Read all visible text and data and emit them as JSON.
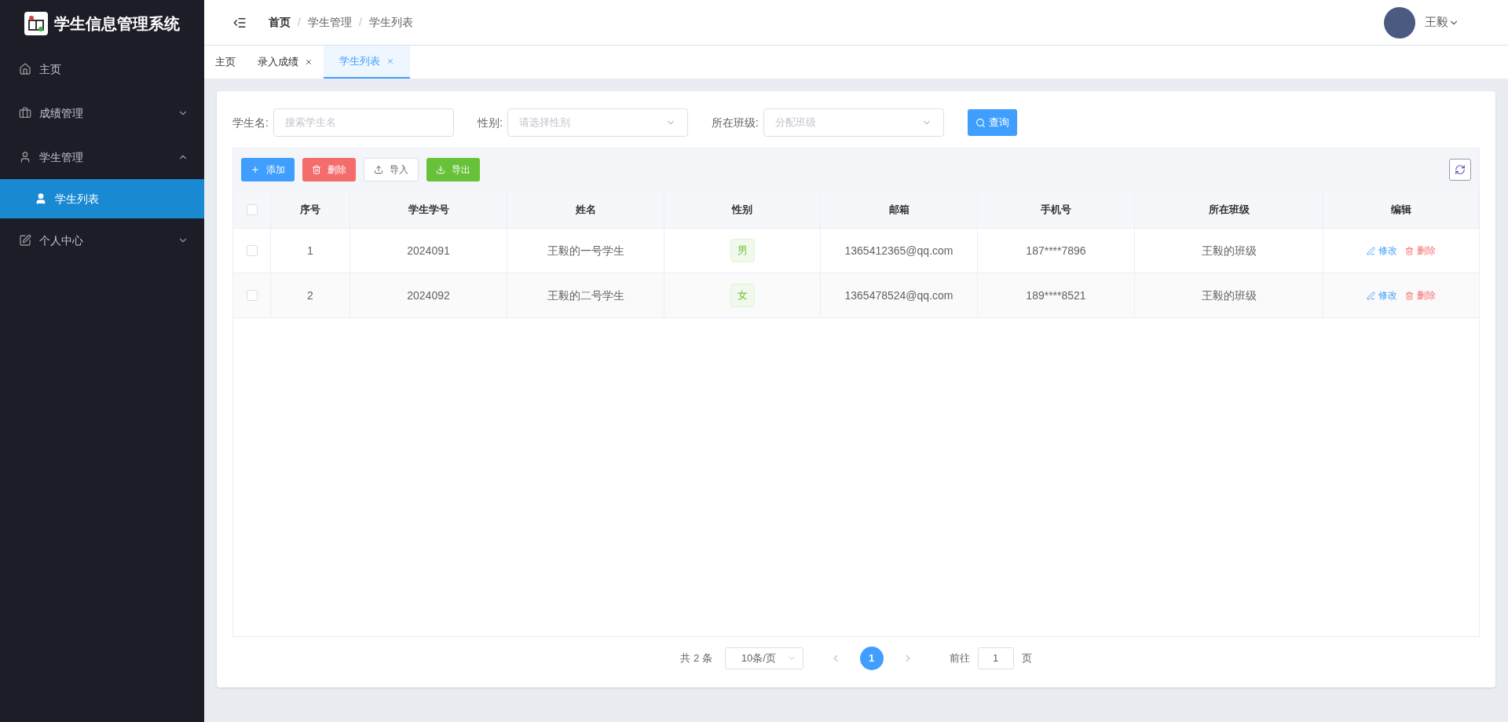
{
  "app": {
    "title": "学生信息管理系统"
  },
  "sidebar": {
    "items": [
      {
        "label": "主页"
      },
      {
        "label": "成绩管理",
        "expanded": false
      },
      {
        "label": "学生管理",
        "expanded": true,
        "children": [
          {
            "label": "学生列表",
            "selected": true
          }
        ]
      },
      {
        "label": "个人中心",
        "expanded": false
      }
    ]
  },
  "breadcrumb": [
    "首页",
    "学生管理",
    "学生列表"
  ],
  "breadcrumb_separator": "/",
  "user": {
    "name": "王毅"
  },
  "tabs": [
    {
      "label": "主页",
      "selected": false,
      "closable": false
    },
    {
      "label": "录入成绩",
      "selected": false,
      "closable": true
    },
    {
      "label": "学生列表",
      "selected": true,
      "closable": true
    }
  ],
  "filters": [
    {
      "kind": "input",
      "label": "学生名:",
      "placeholder": "搜索学生名"
    },
    {
      "kind": "select",
      "label": "性别:",
      "placeholder": "请选择性别"
    },
    {
      "kind": "select",
      "label": "所在班级:",
      "placeholder": "分配班级"
    }
  ],
  "search_button": "查询",
  "toolbar": [
    {
      "kind": "add",
      "label": "添加"
    },
    {
      "kind": "delete",
      "label": "删除"
    },
    {
      "kind": "import",
      "label": "导入"
    },
    {
      "kind": "export",
      "label": "导出"
    }
  ],
  "table": {
    "select_all_checked": false,
    "columns": [
      "序号",
      "学生学号",
      "姓名",
      "性别",
      "邮箱",
      "手机号",
      "所在班级",
      "编辑"
    ],
    "rows": [
      {
        "checked": false,
        "cells": [
          "1",
          "2024091",
          "王毅的一号学生",
          "男",
          "1365412365@qq.com",
          "187****7896",
          "王毅的班级"
        ],
        "actions": [
          "修改",
          "删除"
        ]
      },
      {
        "checked": false,
        "cells": [
          "2",
          "2024092",
          "王毅的二号学生",
          "女",
          "1365478524@qq.com",
          "189****8521",
          "王毅的班级"
        ],
        "actions": [
          "修改",
          "删除"
        ]
      }
    ]
  },
  "pagination": {
    "total": "共 2 条",
    "page_size": "10条/页",
    "pages": [
      {
        "label": "1",
        "selected": true
      }
    ],
    "goto_label": "前往",
    "goto_value": "1",
    "goto_suffix": "页"
  }
}
